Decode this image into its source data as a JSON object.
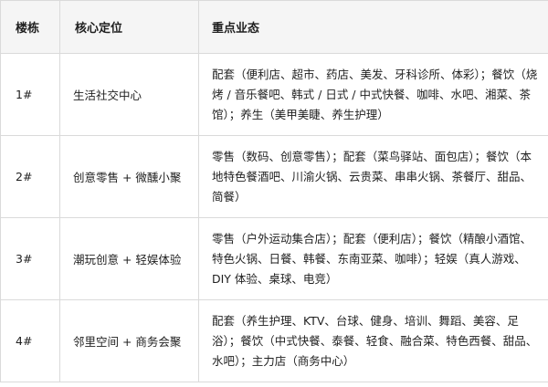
{
  "table": {
    "headers": [
      "楼栋",
      "核心定位",
      "重点业态"
    ],
    "rows": [
      {
        "building": "1#",
        "position": "生活社交中心",
        "formats": "配套（便利店、超市、药店、美发、牙科诊所、体彩）；餐饮（烧烤 / 音乐餐吧、韩式 / 日式 / 中式快餐、咖啡、水吧、湘菜、茶馆）；养生（美甲美睫、养生护理）"
      },
      {
        "building": "2#",
        "position": "创意零售 + 微醺小聚",
        "formats": "零售（数码、创意零售）；配套（菜鸟驿站、面包店）；餐饮（本地特色餐酒吧、川渝火锅、云贵菜、串串火锅、茶餐厅、甜品、简餐）"
      },
      {
        "building": "3#",
        "position": "潮玩创意 + 轻娱体验",
        "formats": "零售（户外运动集合店）；配套（便利店）；餐饮（精酿小酒馆、特色火锅、日餐、韩餐、东南亚菜、咖啡）；轻娱（真人游戏、DIY 体验、桌球、电竞）"
      },
      {
        "building": "4#",
        "position": "邻里空间 + 商务会聚",
        "formats": "配套（养生护理、KTV、台球、健身、培训、舞蹈、美容、足浴）；餐饮（中式快餐、泰餐、轻食、融合菜、特色西餐、甜品、水吧）；主力店（商务中心）"
      }
    ]
  }
}
